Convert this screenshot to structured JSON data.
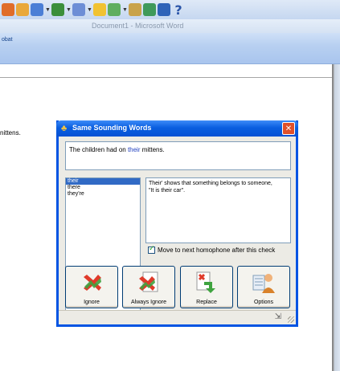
{
  "toolbar": {
    "icons": [
      "shortcut-icon",
      "web-icon",
      "download-icon",
      "search-icon",
      "paint-icon",
      "sparkle-icon",
      "image-icon",
      "lock-icon",
      "tools-icon",
      "book-icon"
    ],
    "help_symbol": "?"
  },
  "window": {
    "title": "Document1 - Microsoft Word"
  },
  "ribbon": {
    "tab_fragment": "obat"
  },
  "document": {
    "visible_text": "nittens."
  },
  "dialog": {
    "title": "Same Sounding Words",
    "close_symbol": "✕",
    "sentence": {
      "before": "The children had on ",
      "word": "their",
      "after": " mittens."
    },
    "words": [
      "their",
      "there",
      "they're"
    ],
    "selected_index": 0,
    "explanation_line1": "Their' shows that something belongs to someone,",
    "explanation_line2": "\"It is their car\".",
    "checkbox_label": "Move to next homophone after this check",
    "checkbox_checked": true,
    "buttons": {
      "ignore": "Ignore",
      "always_ignore": "Always Ignore",
      "replace": "Replace",
      "options": "Options"
    }
  },
  "colors": {
    "dialog_title": "#0a5fe0",
    "selection": "#316ac5",
    "ribbon": "#b8d0f1"
  }
}
